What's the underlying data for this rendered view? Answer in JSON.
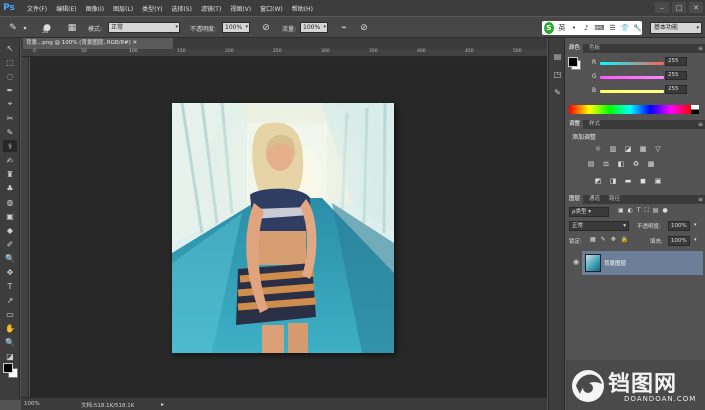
{
  "app": {
    "logo": "Ps"
  },
  "menu": [
    "文件(F)",
    "编辑(E)",
    "图像(I)",
    "图层(L)",
    "类型(Y)",
    "选择(S)",
    "滤镜(T)",
    "视图(V)",
    "窗口(W)",
    "帮助(H)"
  ],
  "window_controls": [
    "–",
    "□",
    "✕"
  ],
  "options_bar": {
    "brush_size": "30",
    "mode_label": "模式:",
    "mode_value": "正常",
    "opacity_label": "不透明度:",
    "opacity_value": "100%",
    "flow_label": "流量:",
    "flow_value": "100%",
    "workspace": "基本功能",
    "sogou_logo": "S",
    "sogou_icons": [
      "英",
      "•",
      "♪",
      "⌨",
      "☰",
      "👕",
      "🔧"
    ]
  },
  "document": {
    "tab_title": "背景...png @ 100% (背景图层, RGB/8#) ✕",
    "zoom": "100%",
    "doc_info": "文档:518.1K/518.1K"
  },
  "ruler_top_labels": [
    "0",
    "50",
    "100",
    "150",
    "200",
    "250",
    "300",
    "350",
    "400",
    "450",
    "500"
  ],
  "color_panel": {
    "tabs": [
      "颜色",
      "色板"
    ],
    "channels": [
      {
        "label": "R",
        "value": "255",
        "color": "#ff5f6b"
      },
      {
        "label": "G",
        "value": "255",
        "color": "#e95bff"
      },
      {
        "label": "B",
        "value": "255",
        "color": "#f6f35a"
      }
    ]
  },
  "adjustments_panel": {
    "tabs": [
      "调整",
      "样式"
    ],
    "title": "添加调整",
    "rows": [
      [
        "☼",
        "▥",
        "◪",
        "▦",
        "▽"
      ],
      [
        "▤",
        "⚖",
        "◧",
        "♻",
        "▦"
      ],
      [
        "◩",
        "◨",
        "▬",
        "◼",
        "▣"
      ]
    ]
  },
  "layers_panel": {
    "tabs": [
      "图层",
      "通道",
      "路径"
    ],
    "filter_label": "ρ类型",
    "blend_mode": "正常",
    "opacity_label": "不透明度:",
    "opacity_value": "100%",
    "lock_label": "锁定:",
    "fill_label": "填充:",
    "fill_value": "100%",
    "layer_name": "背景图层"
  },
  "tools": [
    "↖",
    "⬚",
    "◌",
    "✒",
    "⌖",
    "✂",
    "✎",
    "⚕",
    "✍",
    "♜",
    "♣",
    "◍",
    "▣",
    "◆",
    "✐",
    "🔍",
    "✥",
    "T",
    "↗",
    "▭",
    "✋",
    "🔍",
    "◪"
  ],
  "watermark": {
    "main": "铛图网",
    "sub": "DOANDOAN.COM"
  }
}
